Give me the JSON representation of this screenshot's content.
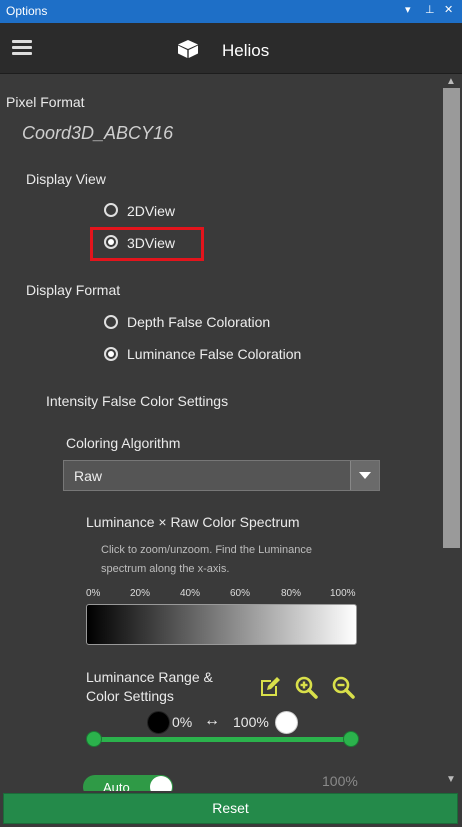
{
  "window": {
    "title": "Options",
    "controls": [
      "▾",
      "⊥",
      "✕"
    ]
  },
  "appbar": {
    "title": "Helios",
    "menu_icon": "hamburger-icon",
    "app_icon": "cube-icon"
  },
  "pixel_format": {
    "label": "Pixel Format",
    "value": "Coord3D_ABCY16"
  },
  "display_view": {
    "label": "Display View",
    "options": [
      {
        "label": "2DView",
        "selected": false
      },
      {
        "label": "3DView",
        "selected": true
      }
    ]
  },
  "display_format": {
    "label": "Display Format",
    "options": [
      {
        "label": "Depth False Coloration",
        "selected": false
      },
      {
        "label": "Luminance False Coloration",
        "selected": true
      }
    ]
  },
  "intensity": {
    "label": "Intensity False Color Settings",
    "coloring_algorithm": {
      "label": "Coloring Algorithm",
      "value": "Raw"
    },
    "spectrum": {
      "title": "Luminance × Raw Color Spectrum",
      "hint_line1": "Click to zoom/unzoom. Find the Luminance",
      "hint_line2": "spectrum along the x-axis.",
      "ticks": [
        "0%",
        "20%",
        "40%",
        "60%",
        "80%",
        "100%"
      ]
    },
    "range": {
      "title_line1": "Luminance Range &",
      "title_line2": "Color Settings",
      "min_label": "0%",
      "max_label": "100%",
      "arrow": "↔",
      "min_value": 0,
      "max_value": 100
    },
    "auto_toggle": {
      "label": "Auto",
      "on": true
    },
    "partial_value": "100%"
  },
  "footer": {
    "reset_label": "Reset"
  },
  "colors": {
    "accent": "#2bb24c",
    "titlebar": "#1e6fc7",
    "highlight": "#e3141c"
  }
}
